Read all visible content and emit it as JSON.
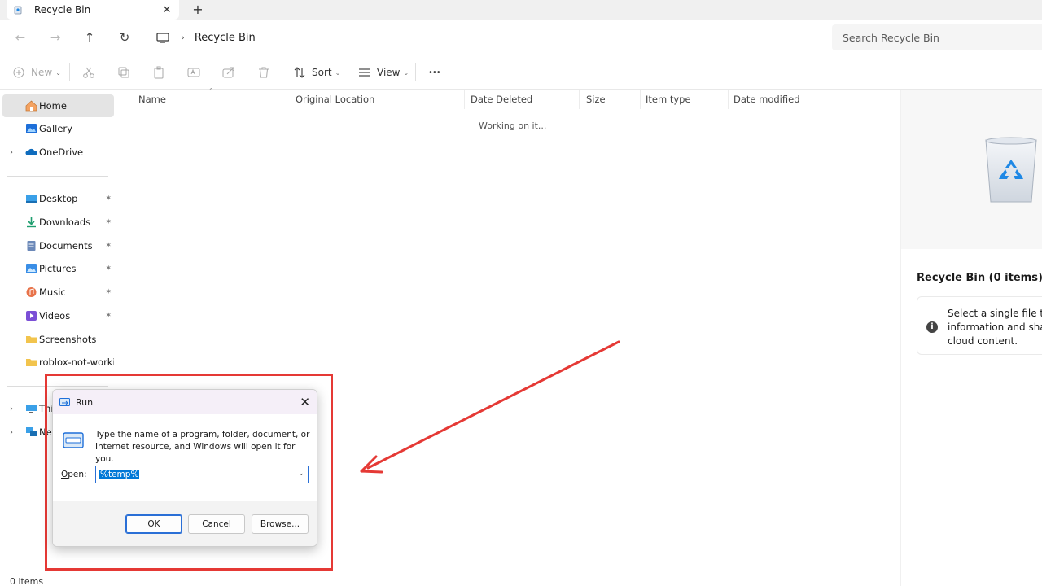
{
  "tab": {
    "title": "Recycle Bin",
    "close": "✕",
    "new_tab": "+"
  },
  "nav": {
    "back": "←",
    "forward": "→",
    "up": "↑",
    "refresh": "↻"
  },
  "address": {
    "separator": "›",
    "crumb": "Recycle Bin"
  },
  "search": {
    "placeholder": "Search Recycle Bin"
  },
  "toolbar": {
    "new_label": "New",
    "sort_label": "Sort",
    "view_label": "View",
    "more": "•••",
    "caret": "⌄"
  },
  "sidebar": {
    "items": [
      {
        "label": "Home",
        "icon": "home-icon"
      },
      {
        "label": "Gallery",
        "icon": "gallery-icon"
      },
      {
        "label": "OneDrive",
        "icon": "onedrive-icon"
      },
      {
        "label": "Desktop",
        "icon": "desktop-icon"
      },
      {
        "label": "Downloads",
        "icon": "downloads-icon"
      },
      {
        "label": "Documents",
        "icon": "documents-icon"
      },
      {
        "label": "Pictures",
        "icon": "pictures-icon"
      },
      {
        "label": "Music",
        "icon": "music-icon"
      },
      {
        "label": "Videos",
        "icon": "videos-icon"
      },
      {
        "label": "Screenshots",
        "icon": "folder-icon"
      },
      {
        "label": "roblox-not-working",
        "icon": "folder-icon"
      },
      {
        "label": "Thi",
        "icon": "this-pc-icon"
      },
      {
        "label": "Net",
        "icon": "network-icon"
      }
    ],
    "chevron": "›",
    "pin": "📌"
  },
  "columns": [
    "Name",
    "Original Location",
    "Date Deleted",
    "Size",
    "Item type",
    "Date modified"
  ],
  "list": {
    "status_text": "Working on it..."
  },
  "details": {
    "title": "Recycle Bin (0 items)",
    "info_icon": "i",
    "info_lines": [
      "Select a single file to",
      "information and share",
      "cloud content."
    ]
  },
  "status_bar": {
    "items": "0 items"
  },
  "run_dialog": {
    "title": "Run",
    "close": "✕",
    "description": "Type the name of a program, folder, document, or Internet resource, and Windows will open it for you.",
    "open_label_prefix": "O",
    "open_label_rest": "pen:",
    "input_value": "%temp%",
    "dropdown_caret": "⌄",
    "ok_label": "OK",
    "cancel_label": "Cancel",
    "browse_label": "Browse..."
  },
  "colors": {
    "accent": "#0078d7",
    "highlight": "#e53935"
  }
}
